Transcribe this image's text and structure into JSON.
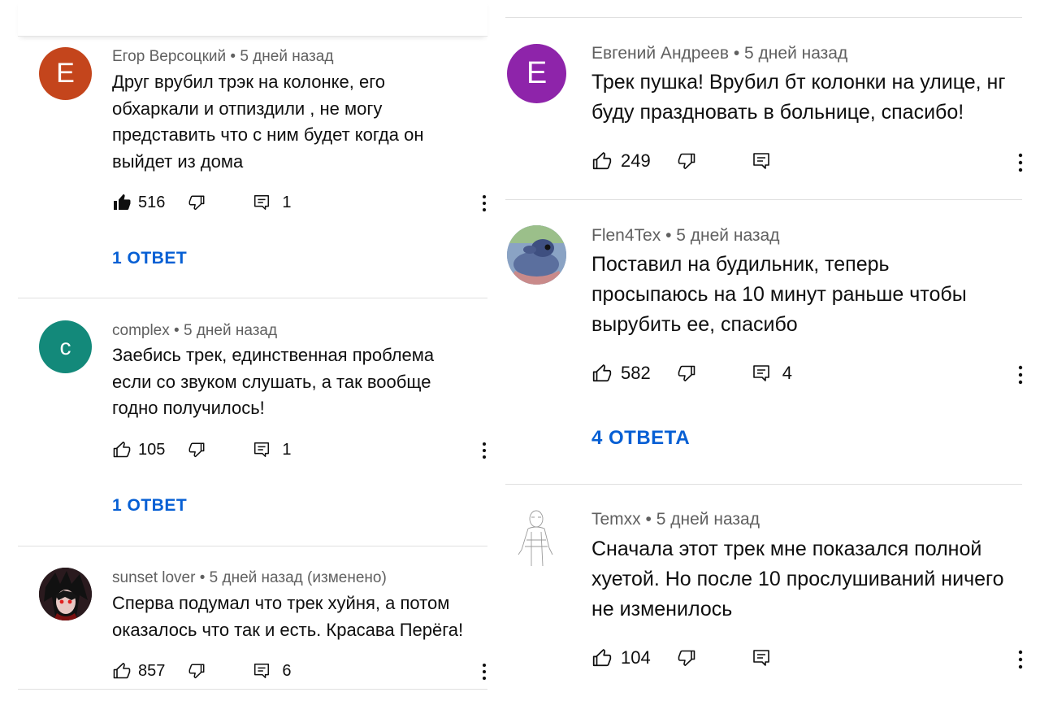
{
  "left_comments": [
    {
      "avatar_letter": "E",
      "avatar_color": "#c4451c",
      "author": "Егор Версоцкий",
      "time": "5 дней назад",
      "text": "Друг врубил трэк на колонке, его обхаркали и отпиздили , не могу представить что с ним будет когда он выйдет из дома",
      "likes": "516",
      "liked": true,
      "reply_count": "1",
      "replies_label": "1 ОТВЕТ"
    },
    {
      "avatar_letter": "c",
      "avatar_color": "#13897a",
      "author": "complex",
      "time": "5 дней назад",
      "text": "Заебись трек, единственная проблема если со звуком слушать, а так вообще годно получилось!",
      "likes": "105",
      "liked": false,
      "reply_count": "1",
      "replies_label": "1 ОТВЕТ"
    },
    {
      "avatar_image": "anime-character-avatar",
      "author": "sunset lover",
      "time": "5 дней назад (изменено)",
      "text": "Сперва подумал что трек хуйня, а потом оказалось что так и есть. Красава Перёга!",
      "likes": "857",
      "liked": false,
      "reply_count": "6"
    }
  ],
  "right_comments": [
    {
      "avatar_letter": "E",
      "avatar_color": "#8e24aa",
      "author": "Евгений Андреев",
      "time": "5 дней назад",
      "text": "Трек пушка!  Врубил бт колонки на улице, нг буду праздновать в больнице, спасибо!",
      "likes": "249",
      "reply_count": ""
    },
    {
      "avatar_image": "cartoon-character-avatar",
      "author": "Flen4Tex",
      "time": "5 дней назад",
      "text": "Поставил на будильник, теперь просыпаюсь на 10 минут раньше чтобы вырубить ее, спасибо",
      "likes": "582",
      "reply_count": "4",
      "replies_label": "4 ОТВЕТА"
    },
    {
      "avatar_image": "sketch-drawing-avatar",
      "author": "Temxx",
      "time": "5 дней назад",
      "text": "Сначала этот трек мне показался полной хуетой. Но после 10 прослушиваний ничего не изменилось",
      "likes": "104",
      "reply_count": ""
    }
  ],
  "separator": "•",
  "icons": {
    "like": "thumbs-up-icon",
    "like_filled": "thumbs-up-filled-icon",
    "dislike": "thumbs-down-icon",
    "reply": "reply-comment-icon",
    "more": "more-vertical-icon"
  },
  "colors": {
    "link_blue": "#065fd4",
    "meta_gray": "#606060"
  }
}
